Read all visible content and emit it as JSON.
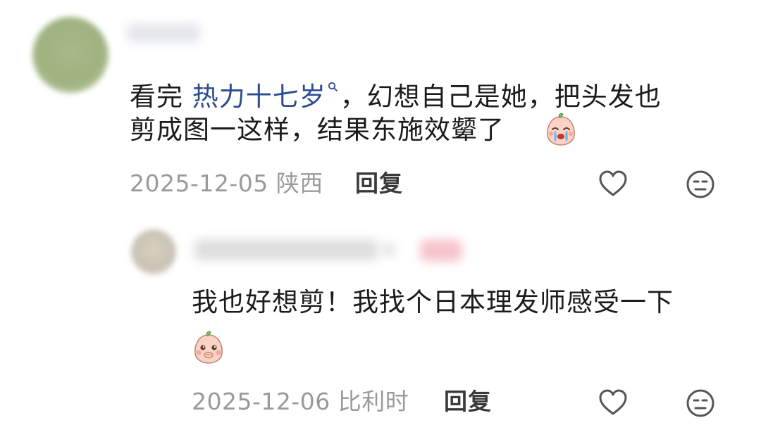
{
  "comment": {
    "text_before": "看完 ",
    "topic": "热力十七岁",
    "text_after": "，幻想自己是她，把头发也",
    "line2": "剪成图一这样，结果东施效颦了",
    "emoji_icon": "crying-peach-emoji",
    "date": "2025-12-05",
    "location": "陕西",
    "reply_label": "回复",
    "like_icon": "heart-icon",
    "dislike_icon": "unamused-face-icon"
  },
  "reply": {
    "line1": "我也好想剪！我找个日本理发师感受一下",
    "emoji_icon": "shy-peach-emoji",
    "date": "2025-12-06",
    "location": "比利时",
    "reply_label": "回复",
    "like_icon": "heart-icon",
    "dislike_icon": "unamused-face-icon"
  },
  "colors": {
    "text": "#1b1b1b",
    "meta": "#9a9a9a",
    "topic_link": "#2b4c8f",
    "icon_stroke": "#555555"
  }
}
